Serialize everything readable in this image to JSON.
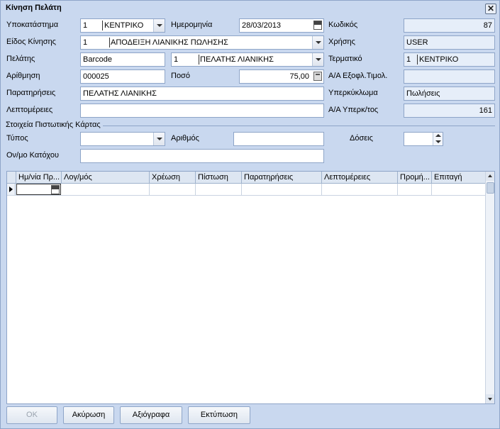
{
  "window": {
    "title": "Κίνηση Πελάτη",
    "close_label": "✕"
  },
  "form": {
    "branch": {
      "label": "Υποκατάστημα",
      "code": "1",
      "name": "ΚΕΝΤΡΙΚΟ"
    },
    "date": {
      "label": "Ημερομηνία",
      "value": "28/03/2013",
      "cal_text": "JAN 1"
    },
    "code": {
      "label": "Κωδικός",
      "value": "87"
    },
    "movement_type": {
      "label": "Είδος Κίνησης",
      "code": "1",
      "name": "ΑΠΟΔΕΙΞΗ ΛΙΑΝΙΚΗΣ ΠΩΛΗΣΗΣ"
    },
    "user": {
      "label": "Χρήσης",
      "value": "USER"
    },
    "customer": {
      "label": "Πελάτης",
      "search_mode": "Barcode",
      "code": "1",
      "name": "ΠΕΛΑΤΗΣ ΛΙΑΝΙΚΗΣ"
    },
    "terminal": {
      "label": "Τερματικό",
      "code": "1",
      "name": "ΚΕΝΤΡΙΚΟ"
    },
    "numbering": {
      "label": "Αρίθμηση",
      "value": "000025"
    },
    "amount": {
      "label": "Ποσό",
      "value": "75,00"
    },
    "invoice_settle_no": {
      "label": "Α/Α Εξοφλ.Τιμολ.",
      "value": ""
    },
    "notes": {
      "label": "Παρατηρήσεις",
      "value": "ΠΕΛΑΤΗΣ ΛΙΑΝΙΚΗΣ"
    },
    "overdraft": {
      "label": "Υπερκύκλωμα",
      "value": "Πωλήσεις"
    },
    "details": {
      "label": "Λεπτομέρειες",
      "value": ""
    },
    "overdraft_no": {
      "label": "Α/Α Υπερκ/τος",
      "value": "161"
    }
  },
  "credit_card": {
    "section_title": "Στοιχεία Πιστωτικής Κάρτας",
    "type": {
      "label": "Τύπος",
      "value": ""
    },
    "number": {
      "label": "Αριθμός",
      "value": ""
    },
    "installments": {
      "label": "Δόσεις",
      "value": ""
    },
    "holder": {
      "label": "Ον/μο Κατόχου",
      "value": ""
    }
  },
  "grid": {
    "columns": [
      "Ημ/νία Πρ...",
      "Λογ/μός",
      "Χρέωση",
      "Πίστωση",
      "Παρατηρήσεις",
      "Λεπτομέρειες",
      "Προμή...",
      "Επιταγή"
    ],
    "cal_text": "JAN 1",
    "rows": []
  },
  "buttons": {
    "ok": "OK",
    "cancel": "Ακύρωση",
    "vouchers": "Αξιόγραφα",
    "print": "Εκτύπωση"
  }
}
